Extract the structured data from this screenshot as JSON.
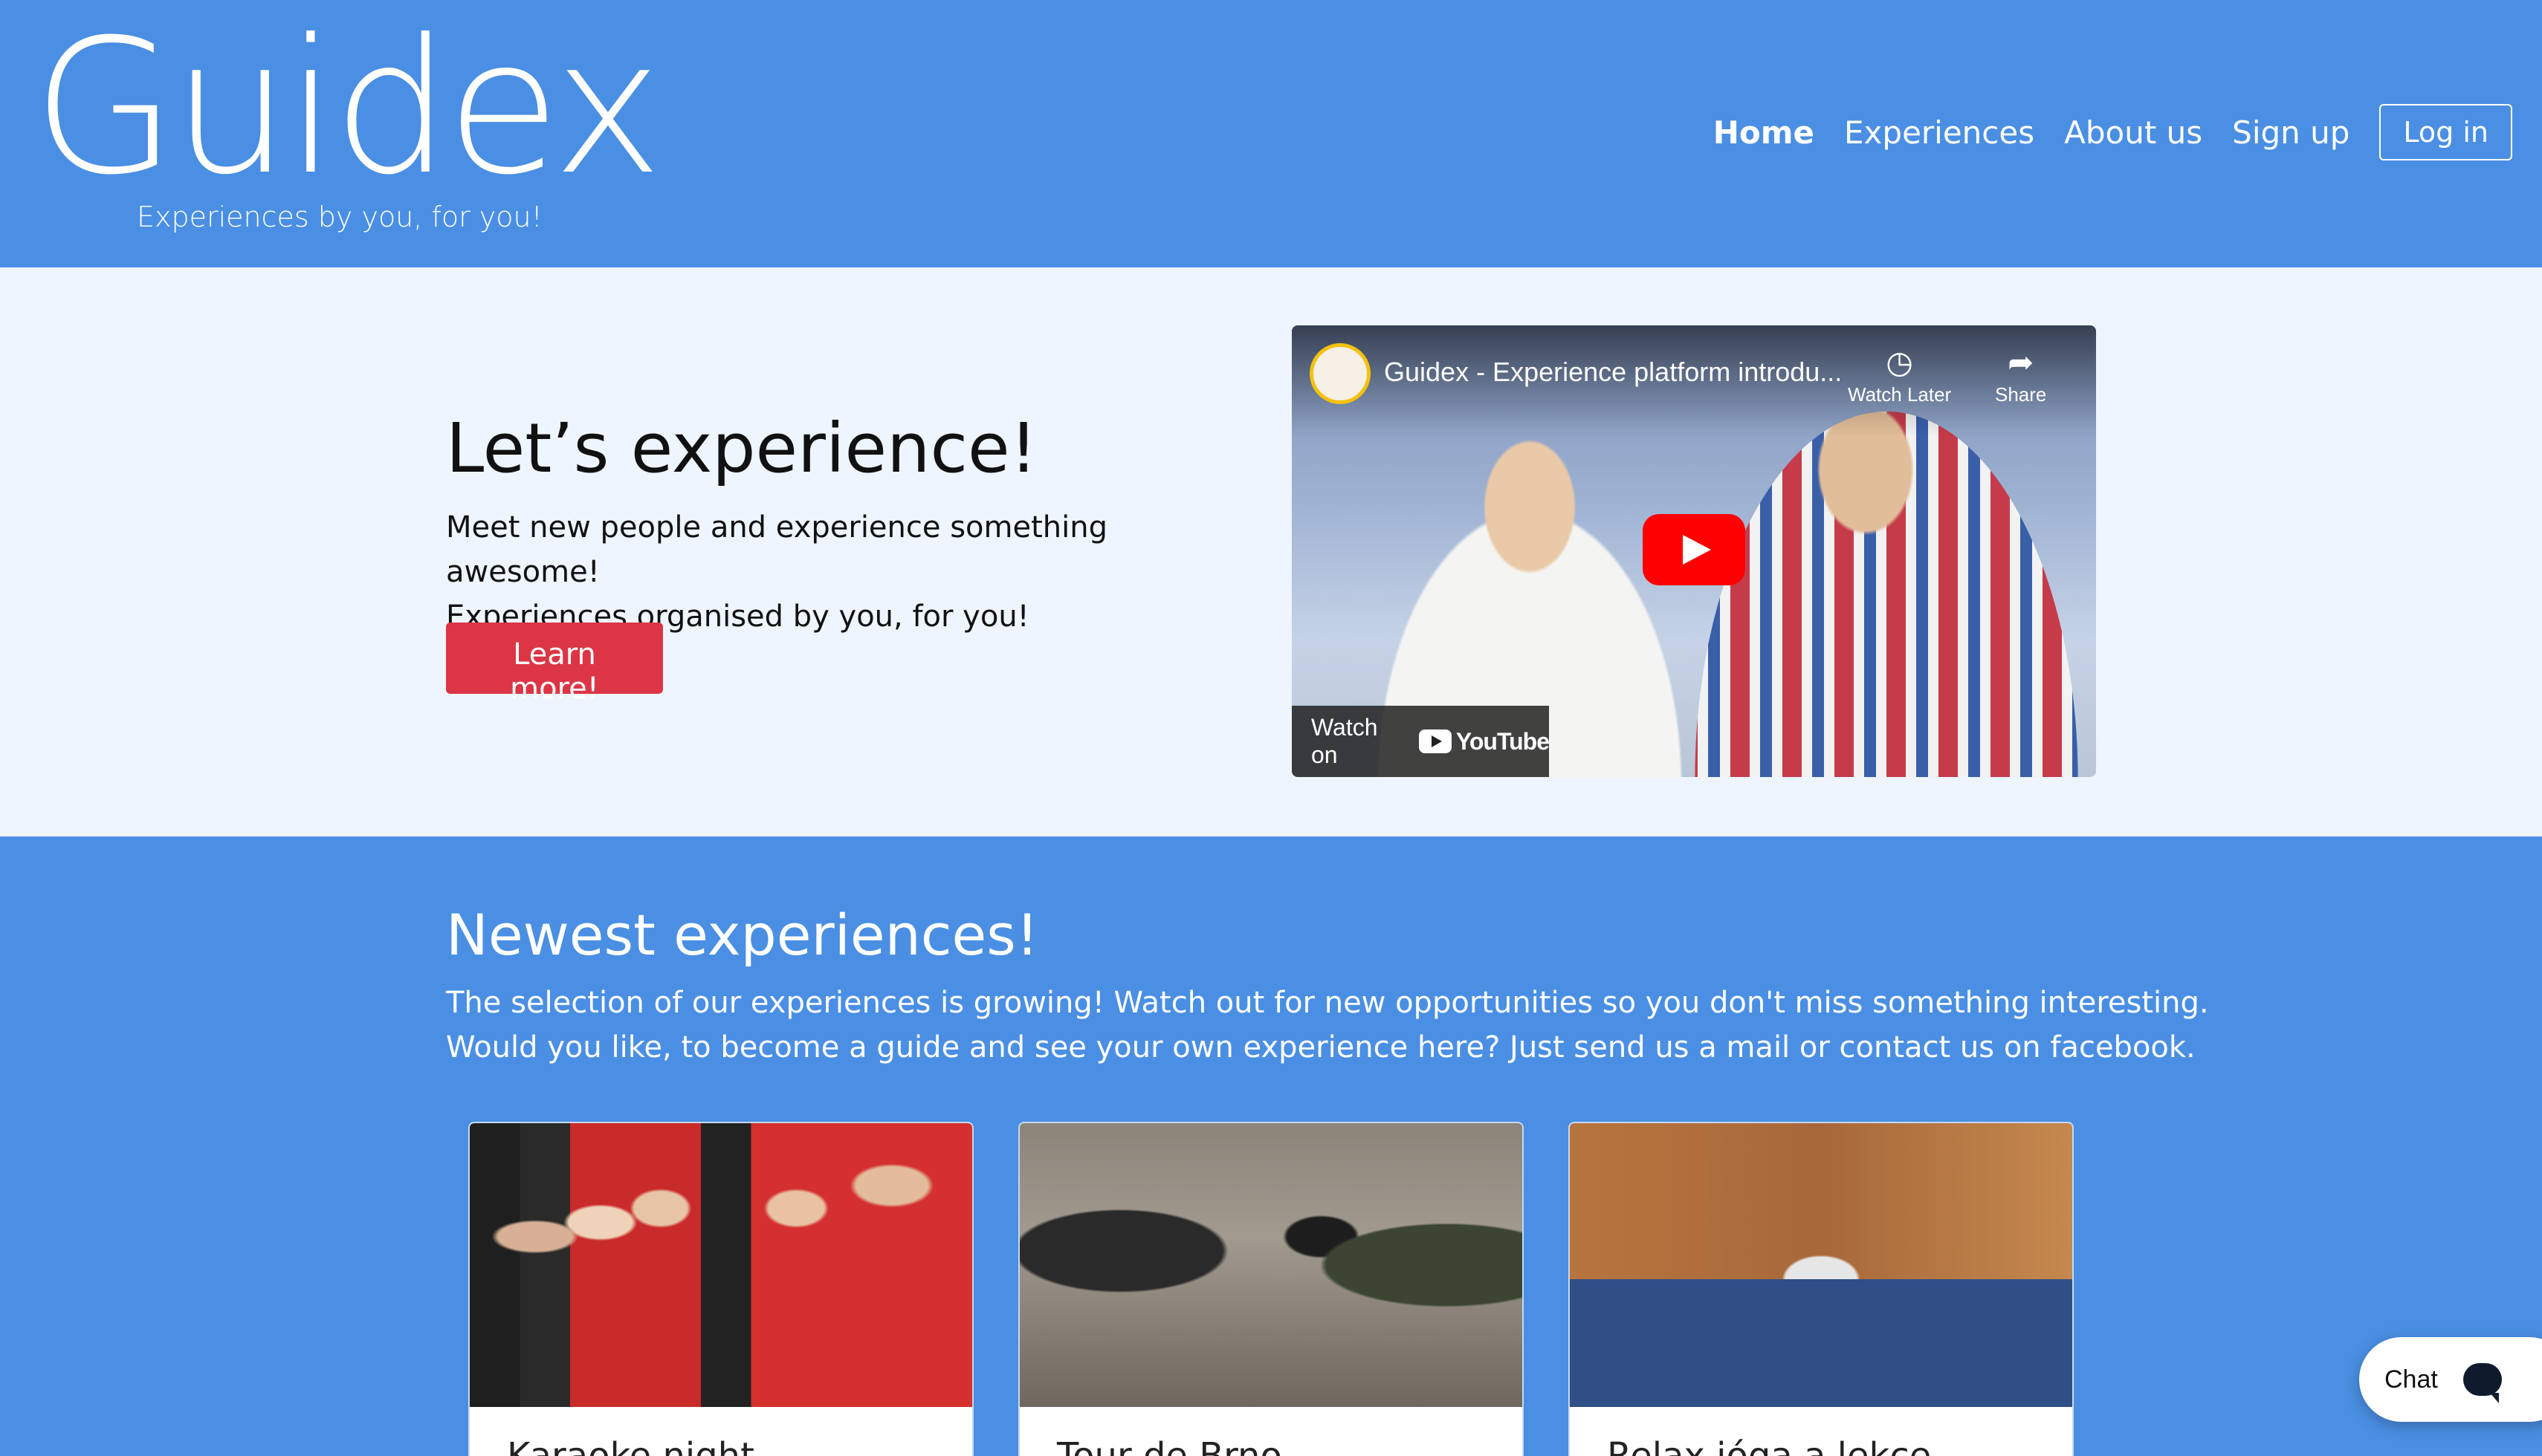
{
  "header": {
    "logo": "Guidex",
    "tagline": "Experiences by you, for you!",
    "nav": {
      "home": "Home",
      "experiences": "Experiences",
      "about": "About us",
      "signup": "Sign up",
      "login": "Log in"
    }
  },
  "hero": {
    "title": "Let’s experience!",
    "line1": "Meet new people and experience something awesome!",
    "line2": "Experiences organised by you, for you!",
    "button": "Learn more!",
    "video": {
      "title": "Guidex - Experience platform introdu...",
      "watch_later": "Watch Later",
      "share": "Share",
      "watch_on": "Watch on",
      "youtube": "YouTube"
    }
  },
  "newest": {
    "title": "Newest experiences!",
    "line1": "The selection of our experiences is growing! Watch out for new opportunities so you don't miss something interesting.",
    "line2": "Would you like, to become a guide and see your own experience here? Just send us a mail or contact us on facebook.",
    "cards": [
      {
        "title": "Karaoke night"
      },
      {
        "title": "Tour de Brno"
      },
      {
        "title": "Relax jóga a lekce"
      }
    ]
  },
  "chat": {
    "label": "Chat"
  },
  "colors": {
    "header_bg": "#4a8fe3",
    "hero_bg": "#eef5ff",
    "button_red": "#dc3545",
    "youtube_red": "#ff0000"
  }
}
